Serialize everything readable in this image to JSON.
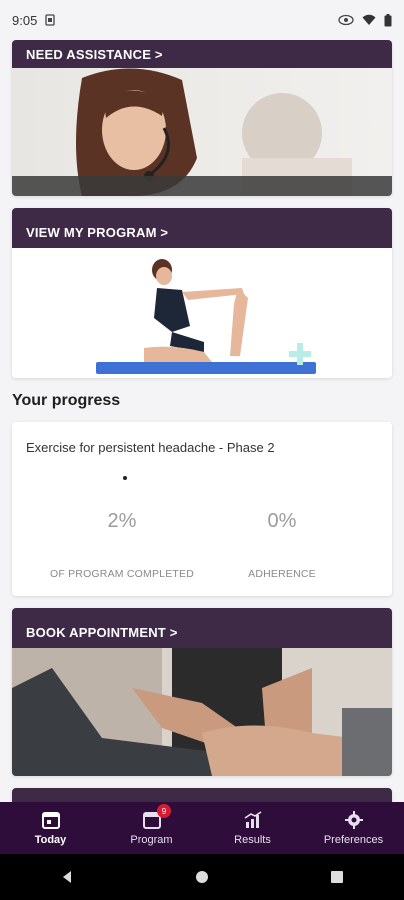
{
  "status": {
    "time": "9:05"
  },
  "cards": {
    "assistance": {
      "label": "NEED ASSISTANCE >"
    },
    "program": {
      "label": "VIEW MY PROGRAM >"
    },
    "appointment": {
      "label": "BOOK APPOINTMENT >"
    }
  },
  "progress": {
    "heading": "Your progress",
    "program_name": "Exercise for persistent headache - Phase 2",
    "completed_value": "2%",
    "completed_label": "OF PROGRAM COMPLETED",
    "adherence_value": "0%",
    "adherence_label": "ADHERENCE"
  },
  "nav": {
    "items": [
      {
        "label": "Today",
        "icon": "calendar-icon",
        "active": true
      },
      {
        "label": "Program",
        "icon": "calendar-badge-icon",
        "badge": "9"
      },
      {
        "label": "Results",
        "icon": "chart-icon"
      },
      {
        "label": "Preferences",
        "icon": "gear-icon"
      }
    ]
  },
  "colors": {
    "header_bg": "#3e2a46",
    "nav_bg": "#2e0d3a",
    "badge": "#d81b31"
  }
}
